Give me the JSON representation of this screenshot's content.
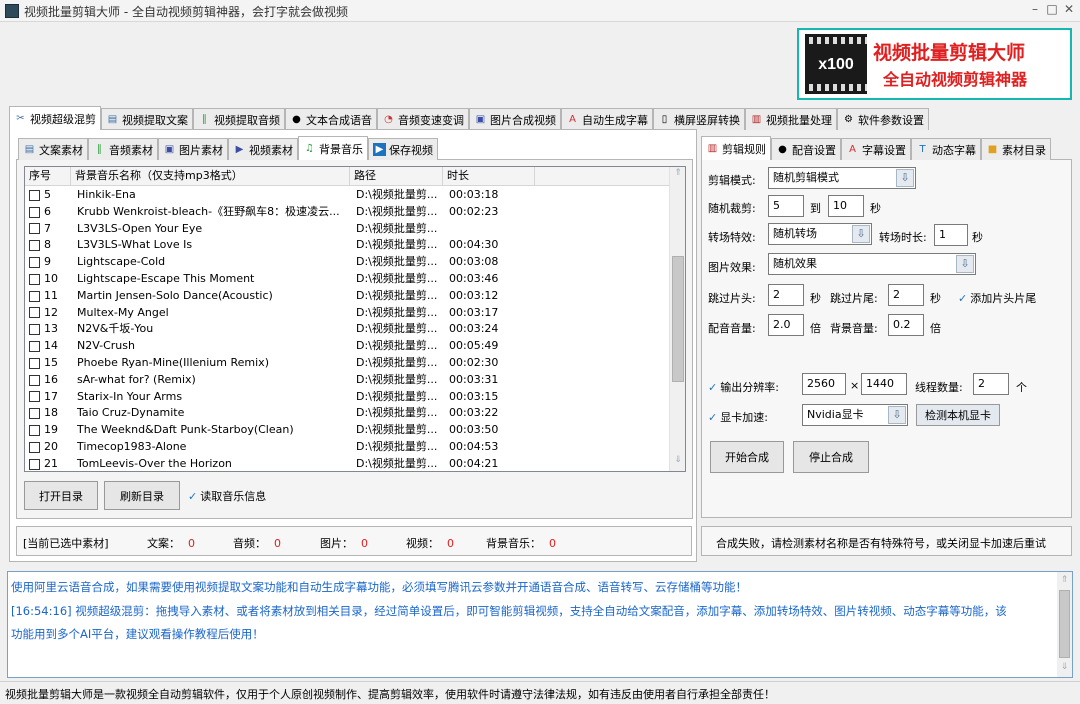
{
  "window": {
    "title": "视频批量剪辑大师 - 全自动视频剪辑神器，会打字就会做视频",
    "min": "–",
    "max": "□",
    "close": "✕"
  },
  "brand": {
    "logo_text": "x100",
    "title": "视频批量剪辑大师",
    "subtitle": "全自动视频剪辑神器"
  },
  "main_tabs": [
    {
      "label": "视频超级混剪",
      "icon": "scissors-icon"
    },
    {
      "label": "视频提取文案",
      "icon": "document-icon"
    },
    {
      "label": "视频提取音频",
      "icon": "audio-wave-icon"
    },
    {
      "label": "文本合成语音",
      "icon": "microphone-icon"
    },
    {
      "label": "音频变速变调",
      "icon": "speedometer-icon"
    },
    {
      "label": "图片合成视频",
      "icon": "image-icon"
    },
    {
      "label": "自动生成字幕",
      "icon": "subtitle-icon"
    },
    {
      "label": "横屏竖屏转换",
      "icon": "rotate-screen-icon"
    },
    {
      "label": "视频批量处理",
      "icon": "film-icon"
    },
    {
      "label": "软件参数设置",
      "icon": "gear-icon"
    }
  ],
  "sub_tabs": [
    {
      "label": "文案素材",
      "icon": "document-icon"
    },
    {
      "label": "音频素材",
      "icon": "audio-wave-icon"
    },
    {
      "label": "图片素材",
      "icon": "image-icon"
    },
    {
      "label": "视频素材",
      "icon": "play-icon"
    },
    {
      "label": "背景音乐",
      "icon": "music-note-icon"
    },
    {
      "label": "保存视频",
      "icon": "save-icon"
    }
  ],
  "table": {
    "headers": [
      "序号",
      "背景音乐名称（仅支持mp3格式）",
      "路径",
      "时长"
    ],
    "rows": [
      {
        "no": "5",
        "name": "Hinkik-Ena",
        "path": "D:\\视频批量剪...",
        "dur": "00:03:18"
      },
      {
        "no": "6",
        "name": "Krubb Wenkroist-bleach-《狂野飙车8：极速凌云...",
        "path": "D:\\视频批量剪...",
        "dur": "00:02:23"
      },
      {
        "no": "7",
        "name": "L3V3LS-Open Your Eye",
        "path": "D:\\视频批量剪...",
        "dur": ""
      },
      {
        "no": "8",
        "name": "L3V3LS-What Love Is",
        "path": "D:\\视频批量剪...",
        "dur": "00:04:30"
      },
      {
        "no": "9",
        "name": "Lightscape-Cold",
        "path": "D:\\视频批量剪...",
        "dur": "00:03:08"
      },
      {
        "no": "10",
        "name": "Lightscape-Escape This Moment",
        "path": "D:\\视频批量剪...",
        "dur": "00:03:46"
      },
      {
        "no": "11",
        "name": "Martin Jensen-Solo Dance(Acoustic)",
        "path": "D:\\视频批量剪...",
        "dur": "00:03:12"
      },
      {
        "no": "12",
        "name": "Multex-My Angel",
        "path": "D:\\视频批量剪...",
        "dur": "00:03:17"
      },
      {
        "no": "13",
        "name": "N2V&千坂-You",
        "path": "D:\\视频批量剪...",
        "dur": "00:03:24"
      },
      {
        "no": "14",
        "name": "N2V-Crush",
        "path": "D:\\视频批量剪...",
        "dur": "00:05:49"
      },
      {
        "no": "15",
        "name": "Phoebe Ryan-Mine(Illenium Remix)",
        "path": "D:\\视频批量剪...",
        "dur": "00:02:30"
      },
      {
        "no": "16",
        "name": "sAr-what for? (Remix)",
        "path": "D:\\视频批量剪...",
        "dur": "00:03:31"
      },
      {
        "no": "17",
        "name": "Starix-In Your Arms",
        "path": "D:\\视频批量剪...",
        "dur": "00:03:15"
      },
      {
        "no": "18",
        "name": "Taio Cruz-Dynamite",
        "path": "D:\\视频批量剪...",
        "dur": "00:03:22"
      },
      {
        "no": "19",
        "name": "The Weeknd&Daft Punk-Starboy(Clean)",
        "path": "D:\\视频批量剪...",
        "dur": "00:03:50"
      },
      {
        "no": "20",
        "name": "Timecop1983-Alone",
        "path": "D:\\视频批量剪...",
        "dur": "00:04:53"
      },
      {
        "no": "21",
        "name": "TomLeevis-Over the Horizon",
        "path": "D:\\视频批量剪...",
        "dur": "00:04:21"
      }
    ]
  },
  "buttons": {
    "open_dir": "打开目录",
    "refresh_dir": "刷新目录",
    "read_music": "读取音乐信息"
  },
  "counts": {
    "label": "[当前已选中素材]",
    "items": [
      {
        "label": "文案：",
        "value": "0"
      },
      {
        "label": "音频：",
        "value": "0"
      },
      {
        "label": "图片：",
        "value": "0"
      },
      {
        "label": "视频：",
        "value": "0"
      },
      {
        "label": "背景音乐：",
        "value": "0"
      }
    ]
  },
  "right_tabs": [
    {
      "label": "剪辑规则",
      "icon": "film-icon"
    },
    {
      "label": "配音设置",
      "icon": "microphone-icon"
    },
    {
      "label": "字幕设置",
      "icon": "subtitle-icon"
    },
    {
      "label": "动态字幕",
      "icon": "text-box-icon"
    },
    {
      "label": "素材目录",
      "icon": "folder-icon"
    }
  ],
  "settings": {
    "mode_label": "剪辑模式:",
    "mode_value": "随机剪辑模式",
    "crop_label": "随机裁剪:",
    "crop_from": "5",
    "crop_to_label": "到",
    "crop_to": "10",
    "sec": "秒",
    "trans_label": "转场特效:",
    "trans_value": "随机转场",
    "trans_dur_label": "转场时长:",
    "trans_dur": "1",
    "img_label": "图片效果:",
    "img_value": "随机效果",
    "skip_head_label": "跳过片头:",
    "skip_head": "2",
    "skip_tail_label": "跳过片尾:",
    "skip_tail": "2",
    "add_head_tail": "添加片头片尾",
    "dub_vol_label": "配音音量:",
    "dub_vol": "2.0",
    "bg_vol_label": "背景音量:",
    "bg_vol": "0.2",
    "times": "倍",
    "res_label": "输出分辨率:",
    "res_w": "2560",
    "res_x": "×",
    "res_h": "1440",
    "threads_label": "线程数量:",
    "threads": "2",
    "threads_unit": "个",
    "gpu_label": "显卡加速:",
    "gpu_value": "Nvidia显卡",
    "detect_gpu": "检测本机显卡",
    "start": "开始合成",
    "stop": "停止合成"
  },
  "status_msg": "合成失败，请检测素材名称是否有特殊符号，或关闭显卡加速后重试",
  "log": [
    "使用阿里云语音合成，如果需要使用视频提取文案功能和自动生成字幕功能，必须填写腾讯云参数并开通语音合成、语音转写、云存储桶等功能！",
    "[16:54:16] 视频超级混剪：拖拽导入素材、或者将素材放到相关目录，经过简单设置后，即可智能剪辑视频，支持全自动给文案配音，添加字幕、添加转场特效、图片转视频、动态字幕等功能，该",
    "功能用到多个AI平台，建议观看操作教程后使用！"
  ],
  "statusbar": "视频批量剪辑大师是一款视频全自动剪辑软件，仅用于个人原创视频制作、提高剪辑效率，使用软件时请遵守法律法规，如有违反由使用者自行承担全部责任！",
  "colors": {
    "accent": "#1e73be",
    "brand_red": "#e02020",
    "brand_border": "#14b8b0"
  }
}
